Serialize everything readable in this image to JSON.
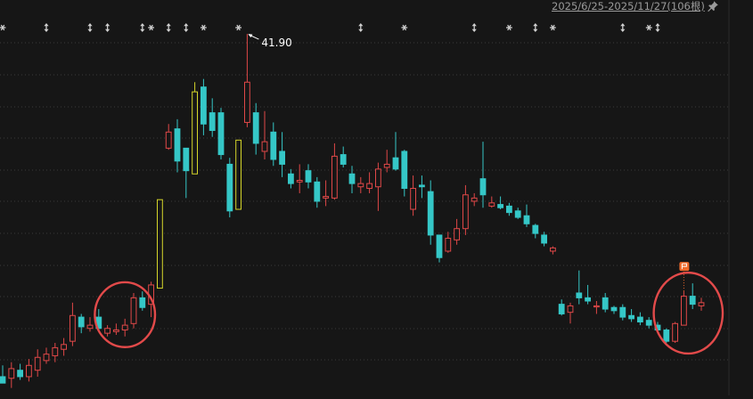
{
  "header": {
    "range_label": "2025/6/25-2025/11/27(106根)"
  },
  "icons": {
    "pin": "pin-icon",
    "event_markers": [
      "info-asterisk-icon",
      "sort-arrows-icon"
    ],
    "flag": "flag-icon"
  },
  "colors": {
    "background": "#161616",
    "up": "#e04848",
    "down": "#35c7c7",
    "limit_up": "#d6d62a",
    "grid": "#3a3a3a",
    "annotation": "#ffffff",
    "circle": "#e24a4a",
    "flag": "#ef6a2b"
  },
  "chart_data": {
    "type": "candlestick",
    "title": "",
    "xlabel": "",
    "ylabel": "",
    "ylim": [
      19.6,
      42.9
    ],
    "grid": "horizontal dashed",
    "max_annotation": {
      "label": "41.90",
      "value": 41.9
    },
    "candles": [
      {
        "o": 20.6,
        "h": 21.3,
        "l": 20.2,
        "c": 20.2,
        "t": "down"
      },
      {
        "o": 20.5,
        "h": 21.5,
        "l": 19.9,
        "c": 21.1,
        "t": "up"
      },
      {
        "o": 21.0,
        "h": 21.4,
        "l": 20.4,
        "c": 20.6,
        "t": "down"
      },
      {
        "o": 20.6,
        "h": 21.7,
        "l": 20.3,
        "c": 21.3,
        "t": "up"
      },
      {
        "o": 21.0,
        "h": 22.3,
        "l": 20.6,
        "c": 21.8,
        "t": "up"
      },
      {
        "o": 21.6,
        "h": 22.4,
        "l": 21.4,
        "c": 22.0,
        "t": "up"
      },
      {
        "o": 21.9,
        "h": 22.7,
        "l": 21.5,
        "c": 22.4,
        "t": "up"
      },
      {
        "o": 22.3,
        "h": 23.0,
        "l": 21.9,
        "c": 22.6,
        "t": "up"
      },
      {
        "o": 22.8,
        "h": 25.2,
        "l": 22.5,
        "c": 24.4,
        "t": "up"
      },
      {
        "o": 24.3,
        "h": 24.5,
        "l": 23.3,
        "c": 23.7,
        "t": "down"
      },
      {
        "o": 23.6,
        "h": 24.3,
        "l": 23.4,
        "c": 23.8,
        "t": "up"
      },
      {
        "o": 24.3,
        "h": 24.8,
        "l": 23.4,
        "c": 23.6,
        "t": "down"
      },
      {
        "o": 23.3,
        "h": 23.8,
        "l": 23.1,
        "c": 23.6,
        "t": "up"
      },
      {
        "o": 23.4,
        "h": 23.9,
        "l": 23.2,
        "c": 23.5,
        "t": "up"
      },
      {
        "o": 23.5,
        "h": 24.2,
        "l": 23.1,
        "c": 23.8,
        "t": "up"
      },
      {
        "o": 23.9,
        "h": 25.8,
        "l": 23.6,
        "c": 25.5,
        "t": "up"
      },
      {
        "o": 25.5,
        "h": 25.9,
        "l": 24.7,
        "c": 24.9,
        "t": "down"
      },
      {
        "o": 25.1,
        "h": 26.5,
        "l": 24.3,
        "c": 26.3,
        "t": "up"
      },
      {
        "o": 26.1,
        "h": 31.6,
        "l": 26.1,
        "c": 31.6,
        "t": "limit"
      },
      {
        "o": 35.8,
        "h": 36.3,
        "l": 34.7,
        "c": 34.8,
        "t": "up"
      },
      {
        "o": 36.0,
        "h": 36.6,
        "l": 33.3,
        "c": 34.0,
        "t": "down"
      },
      {
        "o": 34.8,
        "h": 34.8,
        "l": 31.7,
        "c": 33.4,
        "t": "down"
      },
      {
        "o": 33.2,
        "h": 38.9,
        "l": 33.2,
        "c": 38.3,
        "t": "limit"
      },
      {
        "o": 38.6,
        "h": 39.1,
        "l": 35.6,
        "c": 36.3,
        "t": "down"
      },
      {
        "o": 35.9,
        "h": 37.9,
        "l": 35.5,
        "c": 37.0,
        "t": "down"
      },
      {
        "o": 37.0,
        "h": 37.3,
        "l": 34.1,
        "c": 34.4,
        "t": "down"
      },
      {
        "o": 33.8,
        "h": 34.2,
        "l": 30.5,
        "c": 30.9,
        "t": "down"
      },
      {
        "o": 31.0,
        "h": 35.3,
        "l": 31.0,
        "c": 35.3,
        "t": "limit"
      },
      {
        "o": 36.4,
        "h": 41.9,
        "l": 36.1,
        "c": 38.9,
        "t": "up"
      },
      {
        "o": 37.0,
        "h": 37.6,
        "l": 34.4,
        "c": 35.1,
        "t": "down"
      },
      {
        "o": 35.2,
        "h": 37.1,
        "l": 34.1,
        "c": 34.6,
        "t": "up"
      },
      {
        "o": 35.8,
        "h": 36.4,
        "l": 33.7,
        "c": 34.1,
        "t": "down"
      },
      {
        "o": 34.6,
        "h": 35.8,
        "l": 33.0,
        "c": 33.8,
        "t": "down"
      },
      {
        "o": 33.2,
        "h": 33.5,
        "l": 32.3,
        "c": 32.6,
        "t": "down"
      },
      {
        "o": 32.7,
        "h": 33.8,
        "l": 32.0,
        "c": 32.8,
        "t": "up"
      },
      {
        "o": 33.4,
        "h": 33.8,
        "l": 32.3,
        "c": 32.7,
        "t": "down"
      },
      {
        "o": 32.7,
        "h": 33.0,
        "l": 31.1,
        "c": 31.5,
        "t": "down"
      },
      {
        "o": 31.7,
        "h": 32.8,
        "l": 31.2,
        "c": 31.8,
        "t": "up"
      },
      {
        "o": 31.7,
        "h": 35.1,
        "l": 31.6,
        "c": 34.3,
        "t": "up"
      },
      {
        "o": 34.4,
        "h": 34.9,
        "l": 33.6,
        "c": 33.8,
        "t": "down"
      },
      {
        "o": 33.2,
        "h": 33.7,
        "l": 32.0,
        "c": 32.6,
        "t": "down"
      },
      {
        "o": 32.4,
        "h": 33.0,
        "l": 32.0,
        "c": 32.6,
        "t": "up"
      },
      {
        "o": 32.3,
        "h": 33.3,
        "l": 32.0,
        "c": 32.6,
        "t": "up"
      },
      {
        "o": 32.4,
        "h": 33.9,
        "l": 30.9,
        "c": 33.5,
        "t": "up"
      },
      {
        "o": 33.6,
        "h": 34.7,
        "l": 33.3,
        "c": 33.8,
        "t": "up"
      },
      {
        "o": 34.2,
        "h": 35.8,
        "l": 33.4,
        "c": 33.5,
        "t": "down"
      },
      {
        "o": 34.6,
        "h": 34.7,
        "l": 31.8,
        "c": 32.3,
        "t": "down"
      },
      {
        "o": 31.0,
        "h": 33.1,
        "l": 30.6,
        "c": 32.3,
        "t": "up"
      },
      {
        "o": 32.5,
        "h": 33.1,
        "l": 31.7,
        "c": 32.4,
        "t": "down"
      },
      {
        "o": 32.1,
        "h": 32.8,
        "l": 28.8,
        "c": 29.4,
        "t": "down"
      },
      {
        "o": 29.4,
        "h": 29.4,
        "l": 27.7,
        "c": 28.0,
        "t": "down"
      },
      {
        "o": 28.4,
        "h": 29.6,
        "l": 28.3,
        "c": 29.2,
        "t": "up"
      },
      {
        "o": 29.1,
        "h": 30.4,
        "l": 28.8,
        "c": 29.8,
        "t": "up"
      },
      {
        "o": 29.8,
        "h": 32.5,
        "l": 29.4,
        "c": 31.9,
        "t": "up"
      },
      {
        "o": 31.5,
        "h": 32.0,
        "l": 31.2,
        "c": 31.7,
        "t": "up"
      },
      {
        "o": 32.9,
        "h": 35.2,
        "l": 31.1,
        "c": 31.9,
        "t": "down"
      },
      {
        "o": 31.4,
        "h": 31.8,
        "l": 31.1,
        "c": 31.2,
        "t": "up"
      },
      {
        "o": 31.3,
        "h": 31.8,
        "l": 31.0,
        "c": 31.1,
        "t": "down"
      },
      {
        "o": 31.2,
        "h": 31.4,
        "l": 30.6,
        "c": 30.8,
        "t": "down"
      },
      {
        "o": 30.9,
        "h": 31.1,
        "l": 30.4,
        "c": 30.5,
        "t": "down"
      },
      {
        "o": 30.6,
        "h": 31.3,
        "l": 29.9,
        "c": 30.1,
        "t": "down"
      },
      {
        "o": 30.0,
        "h": 30.1,
        "l": 29.2,
        "c": 29.5,
        "t": "down"
      },
      {
        "o": 29.4,
        "h": 29.6,
        "l": 28.7,
        "c": 28.9,
        "t": "down"
      },
      {
        "o": 28.6,
        "h": 28.7,
        "l": 28.2,
        "c": 28.4,
        "t": "up"
      },
      {
        "o": 25.1,
        "h": 25.4,
        "l": 24.4,
        "c": 24.5,
        "t": "down"
      },
      {
        "o": 24.6,
        "h": 25.2,
        "l": 23.9,
        "c": 25.0,
        "t": "up"
      },
      {
        "o": 25.8,
        "h": 27.2,
        "l": 25.1,
        "c": 25.5,
        "t": "down"
      },
      {
        "o": 25.5,
        "h": 26.3,
        "l": 25.1,
        "c": 25.3,
        "t": "down"
      },
      {
        "o": 25.0,
        "h": 25.3,
        "l": 24.5,
        "c": 25.0,
        "t": "up"
      },
      {
        "o": 25.5,
        "h": 25.8,
        "l": 24.6,
        "c": 24.8,
        "t": "down"
      },
      {
        "o": 24.9,
        "h": 25.0,
        "l": 24.5,
        "c": 24.7,
        "t": "down"
      },
      {
        "o": 24.9,
        "h": 25.1,
        "l": 24.1,
        "c": 24.3,
        "t": "down"
      },
      {
        "o": 24.4,
        "h": 24.8,
        "l": 24.0,
        "c": 24.2,
        "t": "down"
      },
      {
        "o": 24.3,
        "h": 24.6,
        "l": 23.8,
        "c": 24.0,
        "t": "down"
      },
      {
        "o": 24.1,
        "h": 24.3,
        "l": 23.6,
        "c": 23.8,
        "t": "down"
      },
      {
        "o": 23.8,
        "h": 24.0,
        "l": 23.3,
        "c": 23.5,
        "t": "down"
      },
      {
        "o": 23.5,
        "h": 23.6,
        "l": 22.7,
        "c": 22.8,
        "t": "down"
      },
      {
        "o": 22.8,
        "h": 24.0,
        "l": 22.7,
        "c": 23.9,
        "t": "up"
      },
      {
        "o": 23.8,
        "h": 25.9,
        "l": 23.8,
        "c": 25.6,
        "t": "up"
      },
      {
        "o": 25.6,
        "h": 26.4,
        "l": 24.8,
        "c": 25.1,
        "t": "down"
      },
      {
        "o": 25.0,
        "h": 25.5,
        "l": 24.7,
        "c": 25.2,
        "t": "up"
      }
    ],
    "event_markers": [
      {
        "at": 0,
        "kind": "asterisk"
      },
      {
        "at": 5,
        "kind": "arrows"
      },
      {
        "at": 10,
        "kind": "arrows"
      },
      {
        "at": 12,
        "kind": "arrows"
      },
      {
        "at": 16,
        "kind": "arrows"
      },
      {
        "at": 17,
        "kind": "asterisk"
      },
      {
        "at": 19,
        "kind": "arrows"
      },
      {
        "at": 21,
        "kind": "arrows"
      },
      {
        "at": 23,
        "kind": "asterisk"
      },
      {
        "at": 27,
        "kind": "asterisk"
      },
      {
        "at": 41,
        "kind": "arrows"
      },
      {
        "at": 46,
        "kind": "asterisk"
      },
      {
        "at": 54,
        "kind": "arrows"
      },
      {
        "at": 58,
        "kind": "asterisk"
      },
      {
        "at": 61,
        "kind": "arrows"
      },
      {
        "at": 63,
        "kind": "asterisk"
      },
      {
        "at": 71,
        "kind": "arrows"
      },
      {
        "at": 74,
        "kind": "asterisk"
      },
      {
        "at": 75,
        "kind": "arrows"
      }
    ],
    "highlight_circles": [
      {
        "from": 13,
        "to": 15
      },
      {
        "from": 77,
        "to": 80
      }
    ],
    "flag_marker": {
      "at": 78,
      "icon": "flag-icon"
    }
  }
}
